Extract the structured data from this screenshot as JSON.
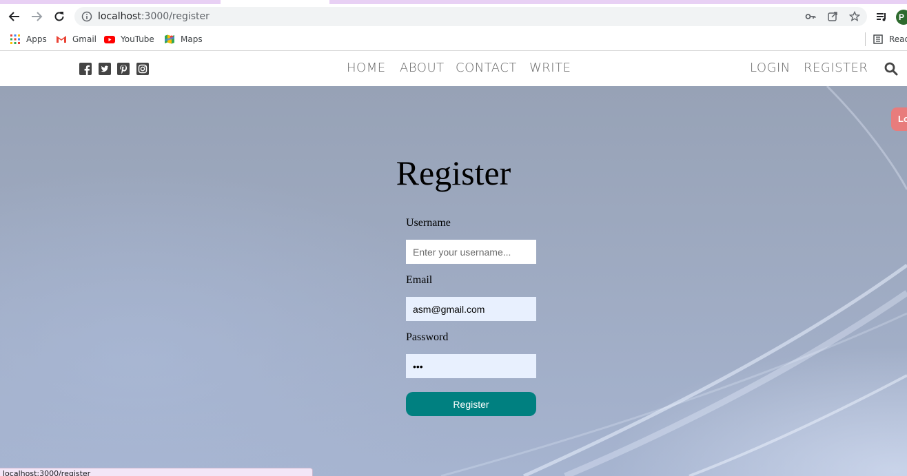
{
  "browser": {
    "url_host": "localhost",
    "url_path": ":3000/register",
    "bookmarks": [
      {
        "label": "Apps",
        "icon": "apps-grid-icon"
      },
      {
        "label": "Gmail",
        "icon": "gmail-icon"
      },
      {
        "label": "YouTube",
        "icon": "youtube-icon"
      },
      {
        "label": "Maps",
        "icon": "maps-icon"
      }
    ],
    "reading_list_label": "Read",
    "profile_initial": "P",
    "status_url": "localhost:3000/register"
  },
  "header": {
    "social_icons": [
      "facebook-icon",
      "twitter-icon",
      "pinterest-icon",
      "instagram-icon"
    ],
    "nav": [
      "HOME",
      "ABOUT",
      "CONTACT",
      "WRITE"
    ],
    "auth": [
      "LOGIN",
      "REGISTER"
    ]
  },
  "side_tab": {
    "label": "Lo"
  },
  "form": {
    "title": "Register",
    "username_label": "Username",
    "username_placeholder": "Enter your username...",
    "username_value": "",
    "email_label": "Email",
    "email_value": "asm@gmail.com",
    "password_label": "Password",
    "password_value": "abc",
    "submit_label": "Register"
  },
  "colors": {
    "accent": "#008080",
    "side_tab": "#e87c7c",
    "autofill": "#e8f0fe"
  }
}
